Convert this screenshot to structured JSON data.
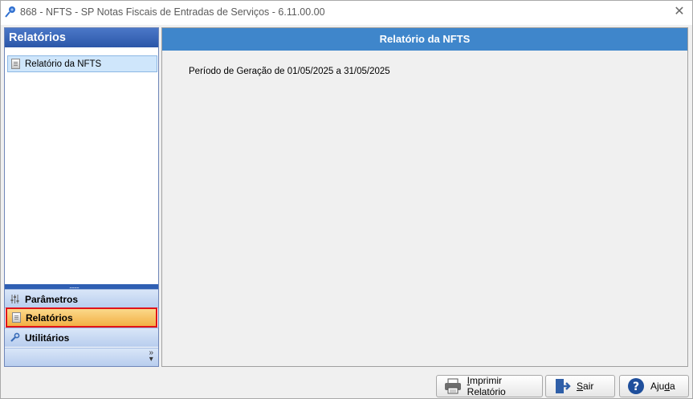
{
  "window": {
    "title": "868 - NFTS - SP  Notas Fiscais de Entradas de Serviços - 6.11.00.00",
    "close_glyph": "✕",
    "app_icon": "pushpin-icon"
  },
  "left_panel": {
    "header": "Relatórios",
    "items": [
      {
        "label": "Relatório da NFTS",
        "icon": "report-icon",
        "selected": true
      }
    ],
    "nav": [
      {
        "label": "Parâmetros",
        "icon": "sliders-icon",
        "active": false
      },
      {
        "label": "Relatórios",
        "icon": "report-icon",
        "active": true
      },
      {
        "label": "Utilitários",
        "icon": "wrench-icon",
        "active": false
      }
    ],
    "more_glyph": "»"
  },
  "main": {
    "header": "Relatório da NFTS",
    "periodo": "Período de Geração de 01/05/2025 a 31/05/2025"
  },
  "footer": {
    "print": {
      "prefix": "",
      "underline": "I",
      "rest": "mprimir Relatório"
    },
    "exit": {
      "underline": "S",
      "rest": "air"
    },
    "help": {
      "prefix": "Aju",
      "underline": "d",
      "rest": "a"
    }
  },
  "colors": {
    "header_blue": "#3f86cb",
    "active_orange": "#f3b045",
    "active_border": "#e0131a"
  }
}
